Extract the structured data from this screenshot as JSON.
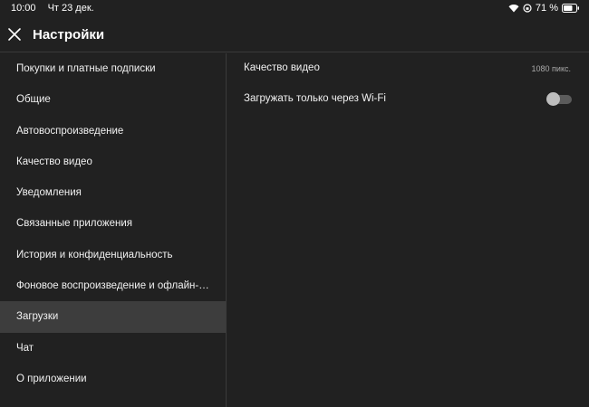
{
  "status": {
    "time": "10:00",
    "date": "Чт 23 дек.",
    "battery": "71 %"
  },
  "header": {
    "title": "Настройки"
  },
  "sidebar": {
    "items": [
      {
        "label": "Покупки и платные подписки"
      },
      {
        "label": "Общие"
      },
      {
        "label": "Автовоспроизведение"
      },
      {
        "label": "Качество видео"
      },
      {
        "label": "Уведомления"
      },
      {
        "label": "Связанные приложения"
      },
      {
        "label": "История и конфиденциальность"
      },
      {
        "label": "Фоновое воспроизведение и офлайн-р..."
      },
      {
        "label": "Загрузки",
        "active": true
      },
      {
        "label": "Чат"
      },
      {
        "label": "О приложении"
      }
    ]
  },
  "downloads": {
    "video_quality_label": "Качество видео",
    "video_quality_value": "1080 пикс.",
    "wifi_only_label": "Загружать только через Wi-Fi",
    "wifi_only_enabled": false
  }
}
